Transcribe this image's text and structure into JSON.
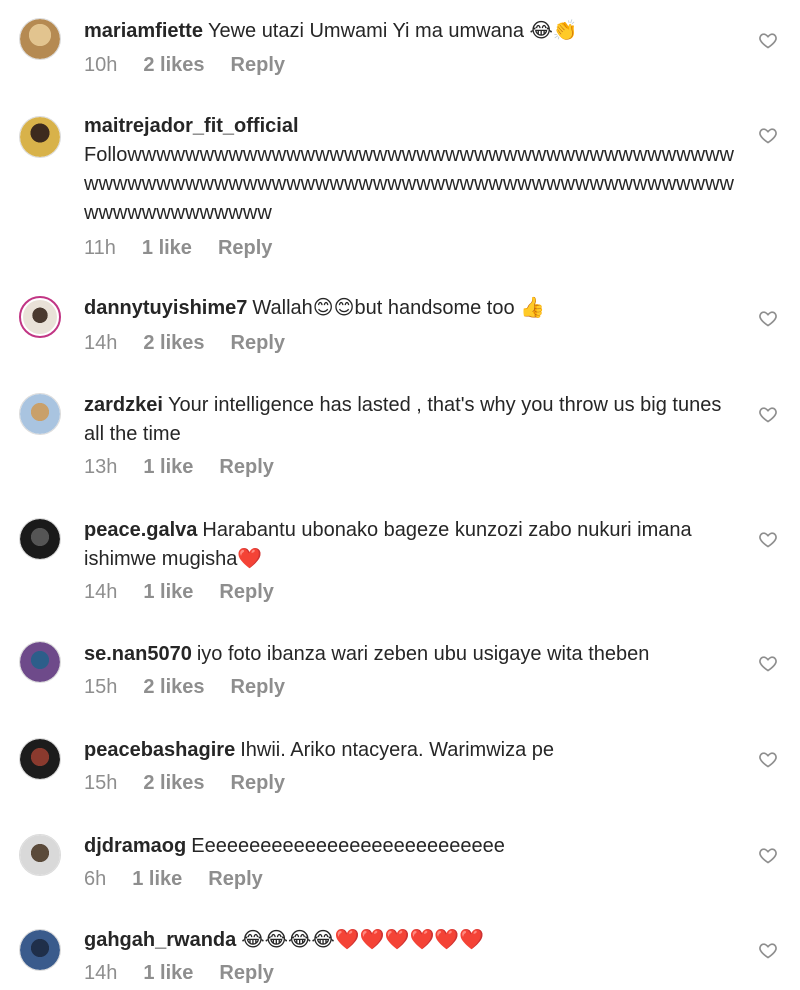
{
  "comments": [
    {
      "user": "mariamfiette",
      "text": "Yewe utazi Umwami Yi ma umwana 😂👏",
      "time": "10h",
      "likes": "2 likes",
      "reply": "Reply",
      "avatar_colors": [
        "#e2c48f",
        "#b58a52"
      ]
    },
    {
      "user": "maitrejador_fit_official",
      "text": "Followwwwwwwwwwwwwwwwwwwwwwwwwwwwwwwwwwwwwwwwwwwwwwwwwwwwwwwwwwwwwwwwwwwwwwwwwwwwwwwwwwwwwwwwwwwwwwwwwwww",
      "time": "11h",
      "likes": "1 like",
      "reply": "Reply",
      "avatar_colors": [
        "#d8b24a",
        "#3c2a1e"
      ]
    },
    {
      "user": "dannytuyishime7",
      "text": "Wallah😊😊but handsome too 👍",
      "time": "14h",
      "likes": "2 likes",
      "reply": "Reply",
      "avatar_colors": [
        "#e9e2d8",
        "#4a3a30"
      ]
    },
    {
      "user": "zardzkei",
      "text": "Your intelligence has lasted , that's why you throw us big tunes all the time",
      "time": "13h",
      "likes": "1 like",
      "reply": "Reply",
      "avatar_colors": [
        "#a9c4e0",
        "#c9a06a"
      ]
    },
    {
      "user": "peace.galva",
      "text": "Harabantu ubonako bageze kunzozi zabo nukuri imana ishimwe mugisha❤️",
      "time": "14h",
      "likes": "1 like",
      "reply": "Reply",
      "avatar_colors": [
        "#555555",
        "#1a1a1a"
      ]
    },
    {
      "user": "se.nan5070",
      "text": "iyo foto ibanza wari zeben ubu usigaye wita theben",
      "time": "15h",
      "likes": "2 likes",
      "reply": "Reply",
      "avatar_colors": [
        "#6e4a8a",
        "#2c5e8a"
      ]
    },
    {
      "user": "peacebashagire",
      "text": "Ihwii. Ariko ntacyera. Warimwiza pe",
      "time": "15h",
      "likes": "2 likes",
      "reply": "Reply",
      "avatar_colors": [
        "#8a3a2e",
        "#1c1c1c"
      ]
    },
    {
      "user": "djdramaog",
      "text": "Eeeeeeeeeeeeeeeeeeeeeeeeeeee",
      "time": "6h",
      "likes": "1 like",
      "reply": "Reply",
      "avatar_colors": [
        "#d9d9d9",
        "#5a4a3a"
      ]
    },
    {
      "user": "gahgah_rwanda",
      "text": "😂😂😂😂❤️❤️❤️❤️❤️❤️",
      "time": "14h",
      "likes": "1 like",
      "reply": "Reply",
      "avatar_colors": [
        "#3a5b8c",
        "#1f2f4a"
      ]
    }
  ],
  "icons": {
    "like": "heart-outline-icon"
  }
}
